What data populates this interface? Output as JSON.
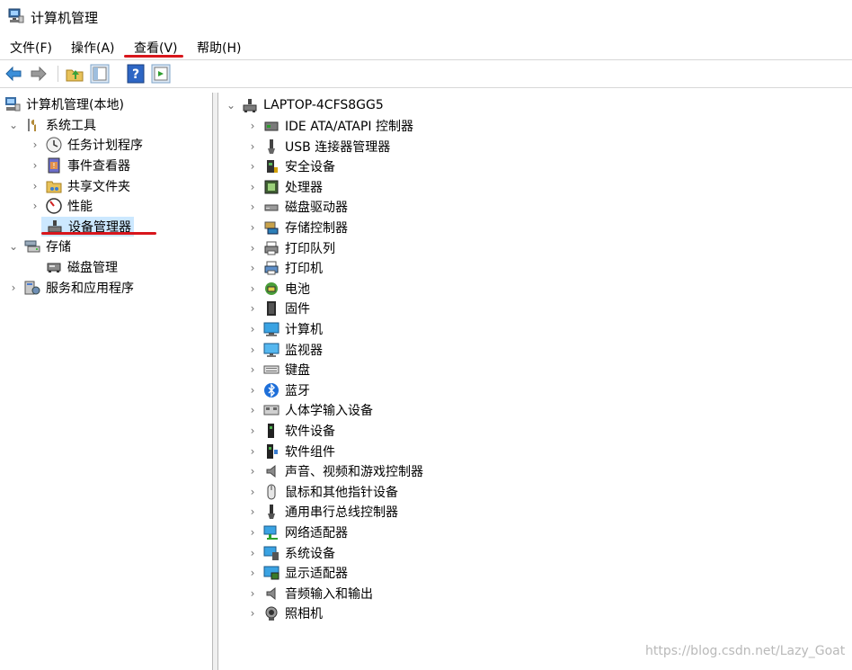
{
  "window": {
    "title": "计算机管理"
  },
  "menu": [
    "文件(F)",
    "操作(A)",
    "查看(V)",
    "帮助(H)"
  ],
  "toolbar": {
    "buttons": [
      "back-icon",
      "forward-icon",
      "up-folder-icon",
      "show-hide-console-tree-icon",
      "help-icon",
      "show-action-pane-icon"
    ]
  },
  "left_tree": {
    "root": "计算机管理(本地)",
    "system_tools": "系统工具",
    "task_scheduler": "任务计划程序",
    "event_viewer": "事件查看器",
    "shared_folders": "共享文件夹",
    "performance": "性能",
    "device_manager": "设备管理器",
    "storage": "存储",
    "disk_management": "磁盘管理",
    "services_apps": "服务和应用程序"
  },
  "device_tree": {
    "computer_name": "LAPTOP-4CFS8GG5",
    "categories": [
      "IDE ATA/ATAPI 控制器",
      "USB 连接器管理器",
      "安全设备",
      "处理器",
      "磁盘驱动器",
      "存储控制器",
      "打印队列",
      "打印机",
      "电池",
      "固件",
      "计算机",
      "监视器",
      "键盘",
      "蓝牙",
      "人体学输入设备",
      "软件设备",
      "软件组件",
      "声音、视频和游戏控制器",
      "鼠标和其他指针设备",
      "通用串行总线控制器",
      "网络适配器",
      "系统设备",
      "显示适配器",
      "音频输入和输出",
      "照相机"
    ]
  },
  "watermark": "https://blog.csdn.net/Lazy_Goat",
  "colors": {
    "selection": "#cce8ff",
    "annotation_red": "#d8161c"
  }
}
